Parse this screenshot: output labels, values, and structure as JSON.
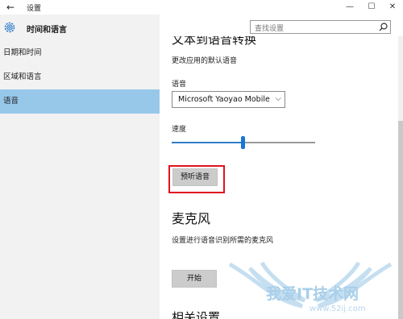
{
  "window": {
    "back_glyph": "←",
    "title": "设置",
    "minimize_glyph": "—",
    "maximize_glyph": "☐",
    "close_glyph": "✕"
  },
  "sidebar": {
    "page_title": "时间和语言",
    "page_icon": "gear-icon",
    "items": [
      {
        "label": "日期和时间",
        "selected": false
      },
      {
        "label": "区域和语言",
        "selected": false
      },
      {
        "label": "语音",
        "selected": true
      }
    ],
    "selected_color": "#97c8ea"
  },
  "search": {
    "placeholder": "查找设置",
    "icon": "search-icon"
  },
  "content": {
    "tts_title_cut": "文本到语音转换",
    "tts_description": "更改应用的默认语音",
    "voice_label": "语音",
    "voice_selected": "Microsoft Yaoyao Mobile",
    "speed_label": "速度",
    "speed_value_fraction": 0.5,
    "preview_button": "预听语音",
    "mic_title": "麦克风",
    "mic_description": "设置进行语音识别所需的麦克风",
    "start_button": "开始",
    "related_title": "相关设置"
  },
  "watermark": {
    "text": "我爱IT技术网",
    "url": "www.52ij.com"
  },
  "colors": {
    "accent": "#1976d2",
    "highlight_box": "#e0141e",
    "button_bg": "#cccccc"
  }
}
